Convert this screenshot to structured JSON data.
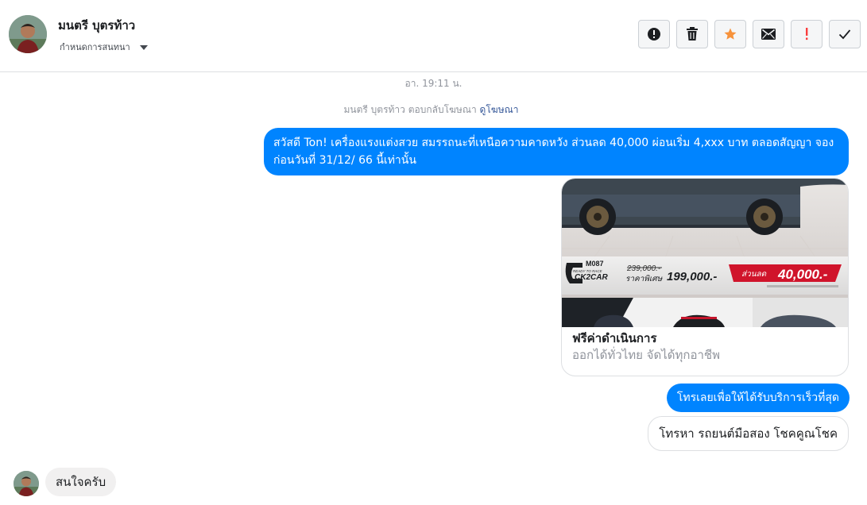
{
  "header": {
    "contact_name": "มนตรี บุตรท้าว",
    "assign_label": "กำหนดการสนทนา",
    "toolbar": [
      {
        "name": "spam-button",
        "icon": "alert-circle-icon"
      },
      {
        "name": "delete-button",
        "icon": "trash-icon"
      },
      {
        "name": "star-button",
        "icon": "star-icon",
        "color": "#f7923b"
      },
      {
        "name": "mark-unread-button",
        "icon": "envelope-icon"
      },
      {
        "name": "follow-up-button",
        "icon": "exclamation-icon",
        "color": "#fa3e3e"
      },
      {
        "name": "mark-done-button",
        "icon": "checkmark-icon"
      }
    ]
  },
  "thread": {
    "timestamp": "อา. 19:11 น.",
    "reply_note": {
      "prefix": "มนตรี บุตรท้าว ตอบกลับโฆษณา",
      "link": "ดูโฆษณา"
    },
    "messages": {
      "ad_text": "สวัสดี Ton! เครื่องแรงแต่งสวย สมรรถนะที่เหนือความคาดหวัง ส่วนลด 40,000 ผ่อนเริ่ม 4,xxx บาท ตลอดสัญญา จองก่อนวันที่ 31/12/ 66 นี้เท่านั้น",
      "card": {
        "title": "ฟรีค่าดำเนินการ",
        "subtitle": "ออกได้ทั่วไทย จัดได้ทุกอาชีพ",
        "image": {
          "model_code": "M087",
          "brand": "CK2CAR",
          "tagline": "READY TO RACE",
          "old_price": "239,000.-",
          "special_label": "ราคาพิเศษ",
          "special_price": "199,000.-",
          "discount_label": "ส่วนลด",
          "discount_amount": "40,000.-"
        }
      },
      "cta_text": "โทรเลยเพื่อให้ได้รับบริการเร็วที่สุด",
      "option_text": "โทรหา รถยนต์มือสอง โชคคูณโชค",
      "user_reply": "สนใจครับ"
    }
  },
  "colors": {
    "accent": "#0084ff",
    "link": "#365899",
    "muted": "#90949c",
    "border": "#dddfe2"
  }
}
